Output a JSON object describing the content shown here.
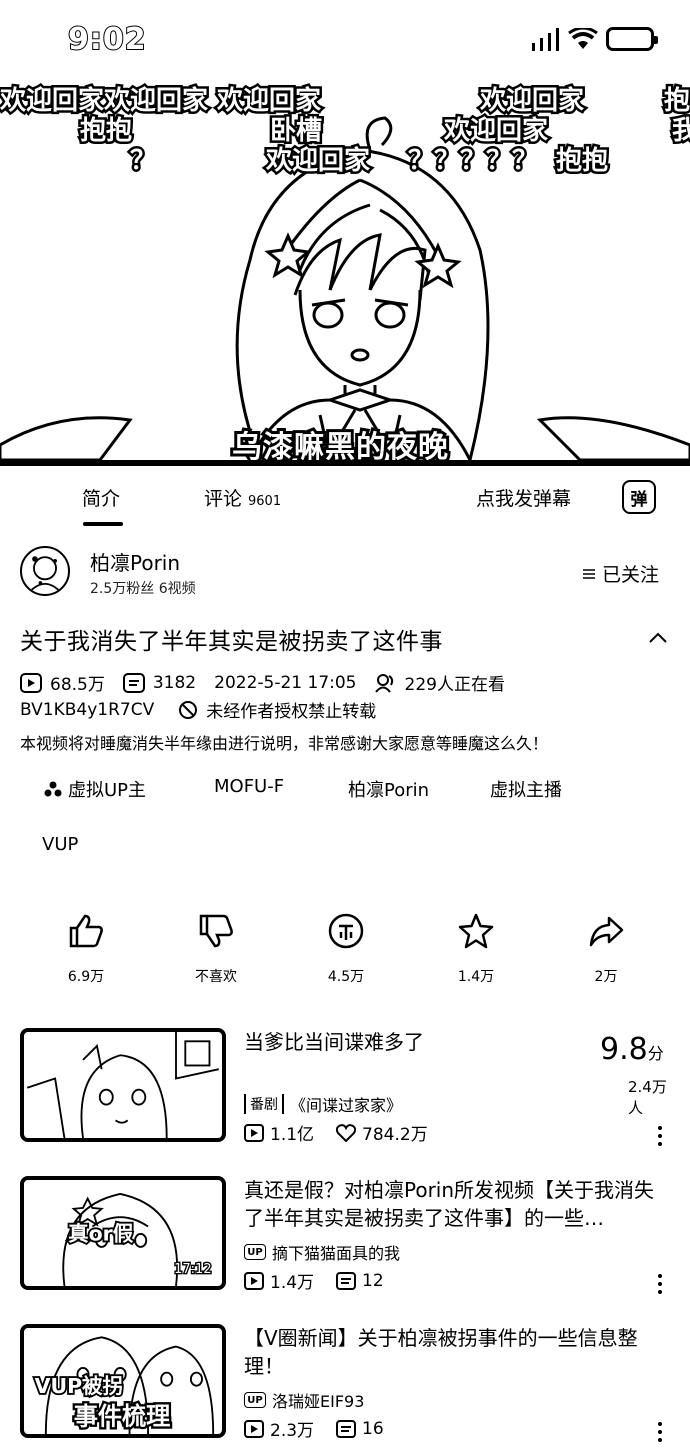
{
  "status_bar": {
    "time": "9:02"
  },
  "video": {
    "danmaku": [
      "欢迎回家欢迎回家 欢迎回家",
      "欢迎回家",
      "抱",
      "抱抱",
      "卧槽",
      "欢迎回家",
      "我",
      "？",
      "欢迎回家",
      "？？？？？",
      "抱抱"
    ],
    "subtitle": "乌漆嘛黑的夜晚"
  },
  "tabs": {
    "intro": "简介",
    "comments": "评论",
    "comment_count": "9601",
    "send_danmaku": "点我发弹幕",
    "danmaku_icon": "弹"
  },
  "uploader": {
    "name": "柏凛Porin",
    "stats": "2.5万粉丝   6视频",
    "follow_label": "已关注"
  },
  "video_info": {
    "title": "关于我消失了半年其实是被拐卖了这件事",
    "views": "68.5万",
    "danmaku_count": "3182",
    "date": "2022-5-21 17:05",
    "watching": "229人正在看",
    "bvid": "BV1KB4y1R7CV",
    "repost_notice": "未经作者授权禁止转载",
    "description": "本视频将对睡魔消失半年缘由进行说明，非常感谢大家愿意等睡魔这么久！"
  },
  "tags": [
    "虚拟UP主",
    "MOFU-F",
    "柏凛Porin",
    "虚拟主播",
    "VUP"
  ],
  "actions": [
    {
      "icon": "thumbs-up-icon",
      "label": "6.9万"
    },
    {
      "icon": "thumbs-down-icon",
      "label": "不喜欢"
    },
    {
      "icon": "coin-icon",
      "label": "4.5万"
    },
    {
      "icon": "star-icon",
      "label": "1.4万"
    },
    {
      "icon": "share-icon",
      "label": "2万"
    }
  ],
  "recommendations": [
    {
      "title": "当爹比当间谍难多了",
      "badge": "番剧",
      "subtitle": "《间谍过家家》",
      "plays": "1.1亿",
      "likes": "784.2万",
      "score": "9.8",
      "score_unit": "分",
      "score_count": "2.4万人"
    },
    {
      "title": "真还是假？对柏凛Porin所发视频【关于我消失了半年其实是被拐卖了这件事】的一些…",
      "badge": "UP",
      "author": "摘下猫猫面具的我",
      "plays": "1.4万",
      "danmaku": "12",
      "thumb_text": "真or假",
      "thumb_duration": "17:12"
    },
    {
      "title": "【V圈新闻】关于柏凛被拐事件的一些信息整理！",
      "badge": "UP",
      "author": "洛瑞娅EIF93",
      "plays": "2.3万",
      "danmaku": "16",
      "thumb_text_1": "VUP被拐",
      "thumb_text_2": "事件梳理"
    }
  ]
}
